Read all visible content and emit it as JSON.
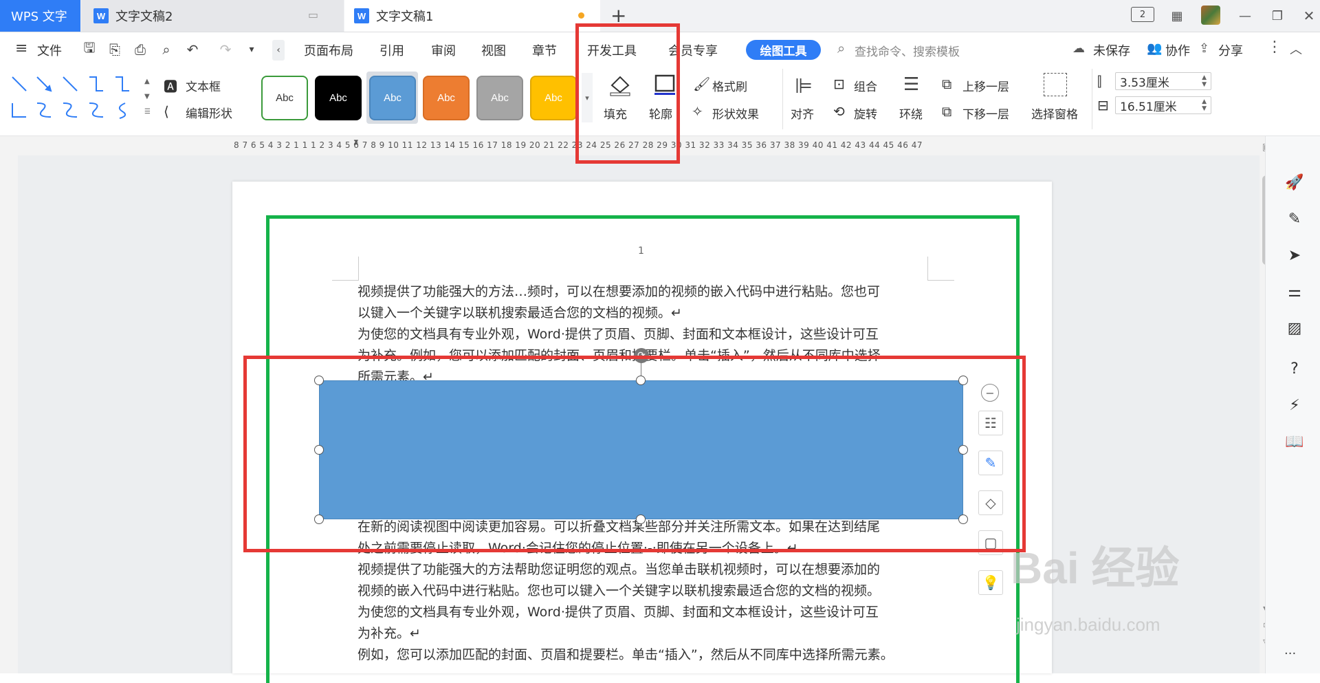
{
  "window": {
    "tabs": [
      {
        "label": "WPS 文字"
      },
      {
        "label": "文字文稿2"
      },
      {
        "label": "文字文稿1"
      }
    ],
    "new_tab": "+",
    "page_count_badge": "2"
  },
  "menu": {
    "file": "文件",
    "items": [
      "页面布局",
      "引用",
      "审阅",
      "视图",
      "章节",
      "开发工具",
      "会员专享"
    ],
    "active_tool": "绘图工具",
    "search_placeholder": "查找命令、搜索模板",
    "unsaved": "未保存",
    "collaborate": "协作",
    "share": "分享"
  },
  "ribbon": {
    "textbox": "文本框",
    "edit_shape": "编辑形状",
    "styles": [
      {
        "label": "Abc",
        "bg": "#ffffff",
        "fg": "#333333",
        "border": "#3a9a3a"
      },
      {
        "label": "Abc",
        "bg": "#000000",
        "fg": "#ffffff",
        "border": "#000000"
      },
      {
        "label": "Abc",
        "bg": "#5b9bd5",
        "fg": "#ffffff",
        "border": "#4a86bd"
      },
      {
        "label": "Abc",
        "bg": "#ed7d31",
        "fg": "#ffffff",
        "border": "#d86d24"
      },
      {
        "label": "Abc",
        "bg": "#a5a5a5",
        "fg": "#ffffff",
        "border": "#909090"
      },
      {
        "label": "Abc",
        "bg": "#ffc000",
        "fg": "#ffffff",
        "border": "#e0a800"
      }
    ],
    "fill": "填充",
    "outline": "轮廓",
    "format_painter": "格式刷",
    "shape_effects": "形状效果",
    "align": "对齐",
    "group": "组合",
    "rotate": "旋转",
    "wrap": "环绕",
    "bring_forward": "上移一层",
    "send_backward": "下移一层",
    "selection_pane": "选择窗格",
    "height_value": "3.53厘米",
    "width_value": "16.51厘米"
  },
  "ruler": {
    "ticks": "8 7 6 5 4 3 2 1 1 1 2 3 4 5 6 7 8 9 10 11 12 13 14 15 16 17 18 19 20 21 22 23 24 25 26 27 28 29 30 31 32 33 34 35 36 37 38 39 40 41 42 43 44 45 46 47"
  },
  "document": {
    "page_number": "1",
    "paragraphs_top": [
      "视频提供了功能强大的方法…频时，可以在想要添加的视频的嵌入代码中进行粘贴。您也可",
      "以键入一个关键字以联机搜索最适合您的文档的视频。↵",
      "为使您的文档具有专业外观，Word·提供了页眉、页脚、封面和文本框设计，这些设计可互",
      "为补充。例如，您可以添加匹配的封面、页眉和提要栏。单击“插入”，然后从不同库中选择",
      "所需元素。↵"
    ],
    "paragraphs_bottom": [
      "在新的阅读视图中阅读更加容易。可以折叠文档某些部分并关注所需文本。如果在达到结尾",
      "处之前需要停止读取，Word·会记住您的停止位置·-·即使在另一个设备上。↵",
      "视频提供了功能强大的方法帮助您证明您的观点。当您单击联机视频时，可以在想要添加的",
      "视频的嵌入代码中进行粘贴。您也可以键入一个关键字以联机搜索最适合您的文档的视频。",
      "为使您的文档具有专业外观，Word·提供了页眉、页脚、封面和文本框设计，这些设计可互",
      "为补充。↵",
      "例如，您可以添加匹配的封面、页眉和提要栏。单击“插入”，然后从不同库中选择所需元素。"
    ],
    "shape_color": "#5b9bd5"
  },
  "watermark": {
    "brand": "Bai 经验",
    "url": "jingyan.baidu.com"
  },
  "right_sidebar": {
    "more": "···"
  }
}
